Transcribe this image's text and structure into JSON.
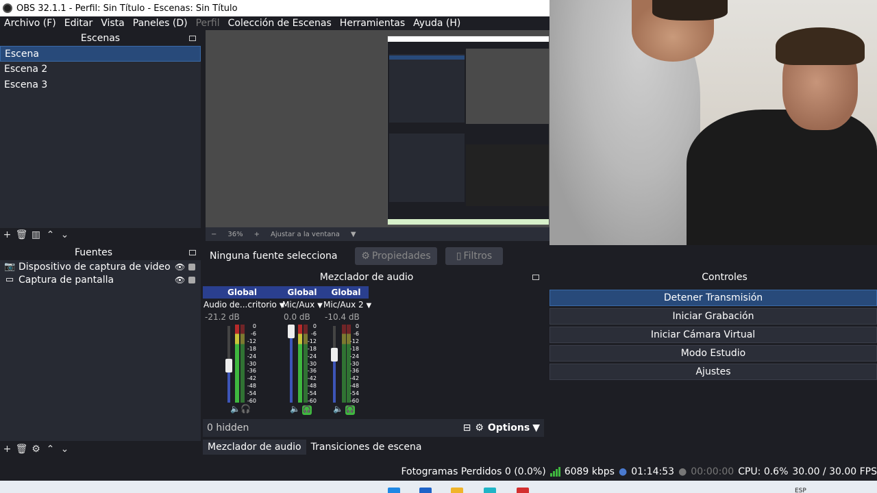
{
  "window": {
    "title": "OBS 32.1.1 - Perfil: Sin Título - Escenas: Sin Título"
  },
  "menu": [
    {
      "label": "Archivo (F)",
      "enabled": true
    },
    {
      "label": "Editar",
      "enabled": true
    },
    {
      "label": "Vista",
      "enabled": true
    },
    {
      "label": "Paneles (D)",
      "enabled": true
    },
    {
      "label": "Perfil",
      "enabled": false
    },
    {
      "label": "Colección de Escenas",
      "enabled": true
    },
    {
      "label": "Herramientas",
      "enabled": true
    },
    {
      "label": "Ayuda (H)",
      "enabled": true
    }
  ],
  "scenes": {
    "title": "Escenas",
    "items": [
      "Escena",
      "Escena 2",
      "Escena 3"
    ],
    "selected": 0
  },
  "sources": {
    "title": "Fuentes",
    "items": [
      "Dispositivo de captura de video",
      "Captura de pantalla"
    ]
  },
  "preview": {
    "zoom": "36%",
    "fit_label": "Ajustar a la ventana"
  },
  "context": {
    "no_source": "Ninguna fuente selecciona",
    "properties": "Propiedades",
    "filters": "Filtros"
  },
  "mixer": {
    "title": "Mezclador de audio",
    "channels": [
      {
        "tag": "Global",
        "name": "Audio de...critorio",
        "db": "-21.2 dB",
        "monitor_on": false
      },
      {
        "tag": "Global",
        "name": "Mic/Aux",
        "db": "0.0 dB",
        "monitor_on": true
      },
      {
        "tag": "Global",
        "name": "Mic/Aux 2",
        "db": "-10.4 dB",
        "monitor_on": true
      }
    ],
    "scale": [
      "0",
      "-6",
      "-12",
      "-18",
      "-24",
      "-30",
      "-36",
      "-42",
      "-48",
      "-54",
      "-60"
    ],
    "hidden": "0 hidden",
    "options": "Options"
  },
  "dock_tabs": [
    "Mezclador de audio",
    "Transiciones de escena"
  ],
  "controls": {
    "title": "Controles",
    "buttons": [
      "Detener Transmisión",
      "Iniciar Grabación",
      "Iniciar Cámara Virtual",
      "Modo Estudio",
      "Ajustes"
    ]
  },
  "status": {
    "dropped_frames": "Fotogramas Perdidos 0 (0.0%)",
    "bitrate": "6089 kbps",
    "stream_time": "01:14:53",
    "rec_time": "00:00:00",
    "cpu": "CPU: 0.6%",
    "fps": "30.00 / 30.00 FPS"
  },
  "taskbar": {
    "lang": "ESP"
  },
  "colors": {
    "accent": "#284a7a",
    "mixer_tag": "#2a3f8f",
    "meter_green": "#3fb83f",
    "panel_bg": "#272a33"
  },
  "icons": [
    "obs-logo-icon",
    "plus-icon",
    "trash-icon",
    "filter-icon",
    "arrow-up-icon",
    "arrow-down-icon",
    "camera-icon",
    "monitor-icon",
    "eye-icon",
    "lock-icon",
    "gear-icon",
    "speaker-icon",
    "headphones-icon",
    "float-icon",
    "signal-bars-icon"
  ]
}
